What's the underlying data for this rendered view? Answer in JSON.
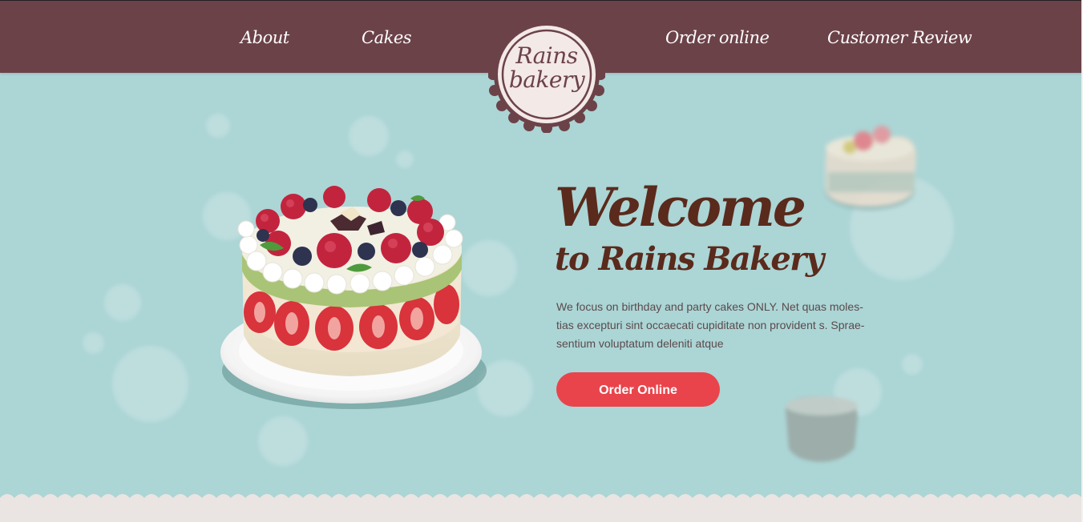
{
  "nav": {
    "items": [
      {
        "label": "About"
      },
      {
        "label": "Cakes"
      },
      {
        "label": "Order online"
      },
      {
        "label": "Customer Review"
      }
    ]
  },
  "logo": {
    "line1": "Rains",
    "line2": "bakery"
  },
  "hero": {
    "title": "Welcome",
    "subtitle": "to Rains Bakery",
    "description_lines": [
      "We focus on birthday and party cakes ONLY.  Net quas moles-",
      "tias excepturi sint occaecati cupiditate non provident s. Sprae-",
      "sentium voluptatum deleniti atque"
    ],
    "cta_label": "Order Online"
  },
  "colors": {
    "header": "#6c4249",
    "background": "#acd5d5",
    "title": "#5a2a1c",
    "button": "#e9444b",
    "footer": "#eae5e2"
  }
}
